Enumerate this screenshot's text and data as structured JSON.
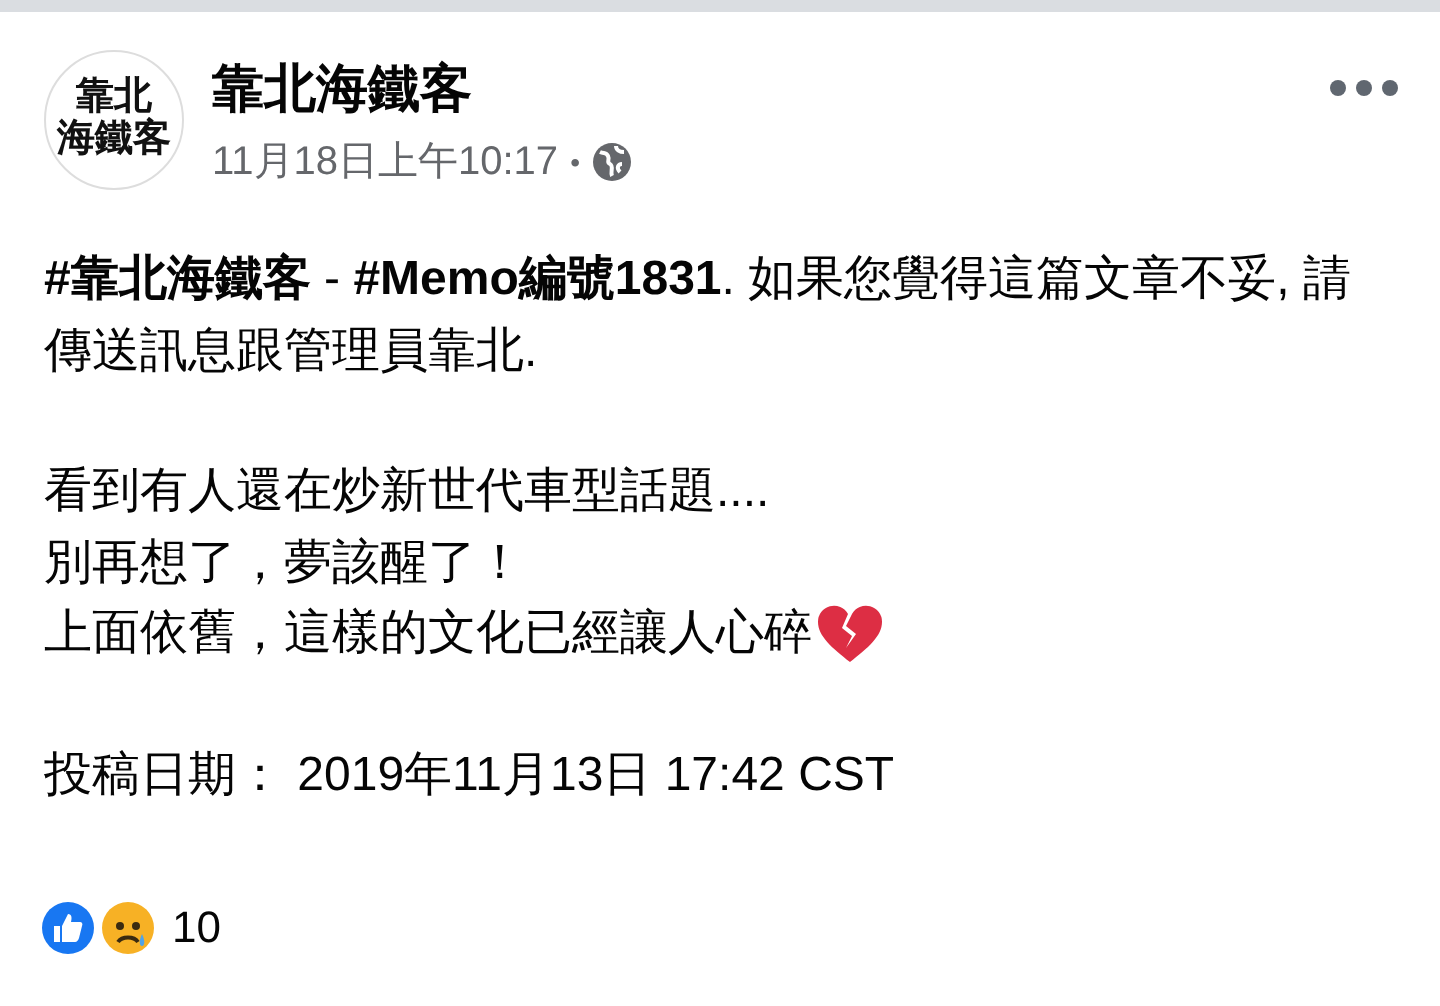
{
  "post": {
    "avatar_lines": [
      "靠北",
      "海鐵客"
    ],
    "author": "靠北海鐵客",
    "timestamp": "11月18日上午10:17",
    "separator": "•",
    "paragraphs": [
      {
        "lines": [
          "**#靠北海鐵客** - **#Memo編號1831**. 如果您覺得這篇文章不妥, 請傳送訊息跟管理員靠北."
        ]
      },
      {
        "lines": [
          "看到有人還在炒新世代車型話題....",
          "別再想了，夢該醒了！",
          "上面依舊，這樣的文化已經讓人心碎"
        ]
      },
      {
        "lines": [
          "投稿日期：  2019年11月13日 17:42 CST"
        ]
      }
    ],
    "reaction_count": "10"
  }
}
